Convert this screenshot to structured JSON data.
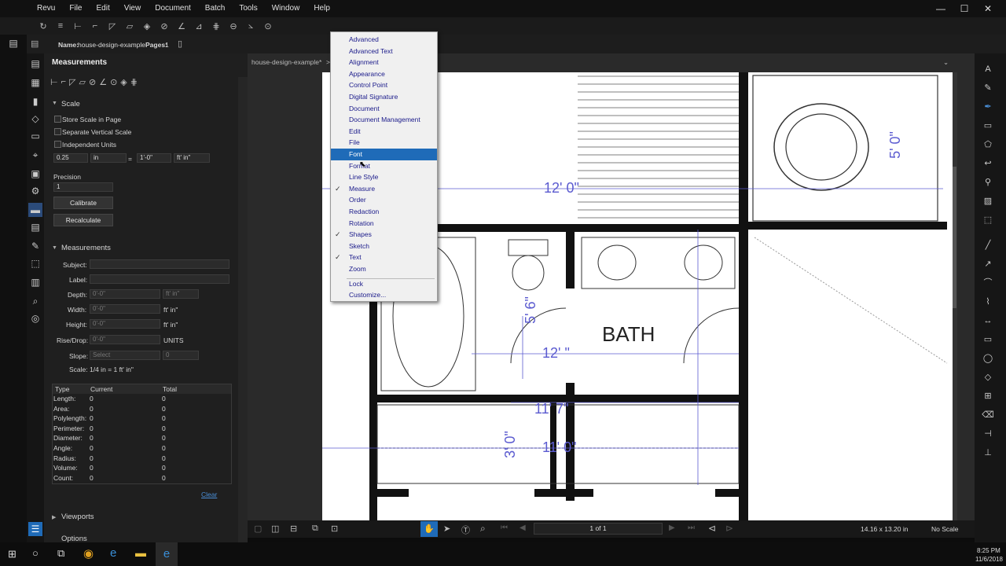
{
  "menubar": {
    "items": [
      "Revu",
      "File",
      "Edit",
      "View",
      "Document",
      "Batch",
      "Tools",
      "Window",
      "Help"
    ]
  },
  "window_controls": {
    "minimize": "—",
    "maximize": "☐",
    "close": "✕"
  },
  "propbar": {
    "name_label": "Name:",
    "name_value": "house-design-example",
    "pages_label": "Pages:",
    "pages_value": "1"
  },
  "panel": {
    "title": "Measurements",
    "scale_section": "Scale",
    "store_scale": "Store Scale in Page",
    "separate_vertical": "Separate Vertical Scale",
    "independent_units": "Independent Units",
    "scale_value": "0.25",
    "scale_unit": "in",
    "scale_eq": "=",
    "scale_value2": "1'-0\"",
    "scale_unit2": "ft' in\"",
    "precision_label": "Precision",
    "precision_value": "1",
    "calibrate": "Calibrate",
    "recalculate": "Recalculate",
    "measurements_section": "Measurements",
    "subject_label": "Subject:",
    "label_label": "Label:",
    "depth_label": "Depth:",
    "depth_value": "0'-0\"",
    "depth_unit": "ft' in\"",
    "width_label": "Width:",
    "width_value": "0'-0\"",
    "width_unit": "ft' in\"",
    "height_label": "Height:",
    "height_value": "0'-0\"",
    "height_unit": "ft' in\"",
    "risedrop_label": "Rise/Drop:",
    "risedrop_value": "0'-0\"",
    "risedrop_unit": "UNITS",
    "slope_label": "Slope:",
    "slope_value": "Select",
    "slope_value2": "0",
    "scale_label": "Scale:",
    "scale_text": "1/4 in = 1 ft' in\"",
    "table_headers": [
      "Type",
      "Current",
      "Total"
    ],
    "table_rows": [
      [
        "Length:",
        "0",
        "0"
      ],
      [
        "Area:",
        "0",
        "0"
      ],
      [
        "Polylength:",
        "0",
        "0"
      ],
      [
        "Perimeter:",
        "0",
        "0"
      ],
      [
        "Diameter:",
        "0",
        "0"
      ],
      [
        "Angle:",
        "0",
        "0"
      ],
      [
        "Radius:",
        "0",
        "0"
      ],
      [
        "Volume:",
        "0",
        "0"
      ],
      [
        "Count:",
        "0",
        "0"
      ]
    ],
    "clear": "Clear",
    "viewports": "Viewports",
    "options": "Options"
  },
  "document": {
    "tab": "house-design-example*",
    "tab_arrow": ">",
    "room_label": "BATH"
  },
  "drawing_dims": {
    "d1": "12' 0\"",
    "d2": "5' 6\"",
    "d3": "12' \"",
    "d4": "5' 0\"",
    "d5": "3' 0\"",
    "d6": "11' 7\"",
    "d7": "11' 0\""
  },
  "context_menu": {
    "items": [
      {
        "label": "Advanced",
        "checked": false
      },
      {
        "label": "Advanced Text",
        "checked": false
      },
      {
        "label": "Alignment",
        "checked": false
      },
      {
        "label": "Appearance",
        "checked": false
      },
      {
        "label": "Control Point",
        "checked": false
      },
      {
        "label": "Digital Signature",
        "checked": false
      },
      {
        "label": "Document",
        "checked": false
      },
      {
        "label": "Document Management",
        "checked": false
      },
      {
        "label": "Edit",
        "checked": false
      },
      {
        "label": "File",
        "checked": false
      },
      {
        "label": "Font",
        "checked": false,
        "highlighted": true
      },
      {
        "label": "Format",
        "checked": false
      },
      {
        "label": "Line Style",
        "checked": false
      },
      {
        "label": "Measure",
        "checked": true
      },
      {
        "label": "Order",
        "checked": false
      },
      {
        "label": "Redaction",
        "checked": false
      },
      {
        "label": "Rotation",
        "checked": false
      },
      {
        "label": "Shapes",
        "checked": true
      },
      {
        "label": "Sketch",
        "checked": false
      },
      {
        "label": "Text",
        "checked": true
      },
      {
        "label": "Zoom",
        "checked": false
      }
    ],
    "extra": [
      {
        "label": "Lock"
      },
      {
        "label": "Customize..."
      }
    ]
  },
  "status": {
    "page": "1 of 1",
    "size": "14.16 x 13.20 in",
    "scale": "No Scale"
  },
  "taskbar": {
    "time": "8:25 PM",
    "date": "11/6/2018"
  },
  "colors": {
    "accent": "#1f6bb8",
    "panel_bg": "#1f1f1f",
    "dimension_blue": "#5b5bd0"
  }
}
